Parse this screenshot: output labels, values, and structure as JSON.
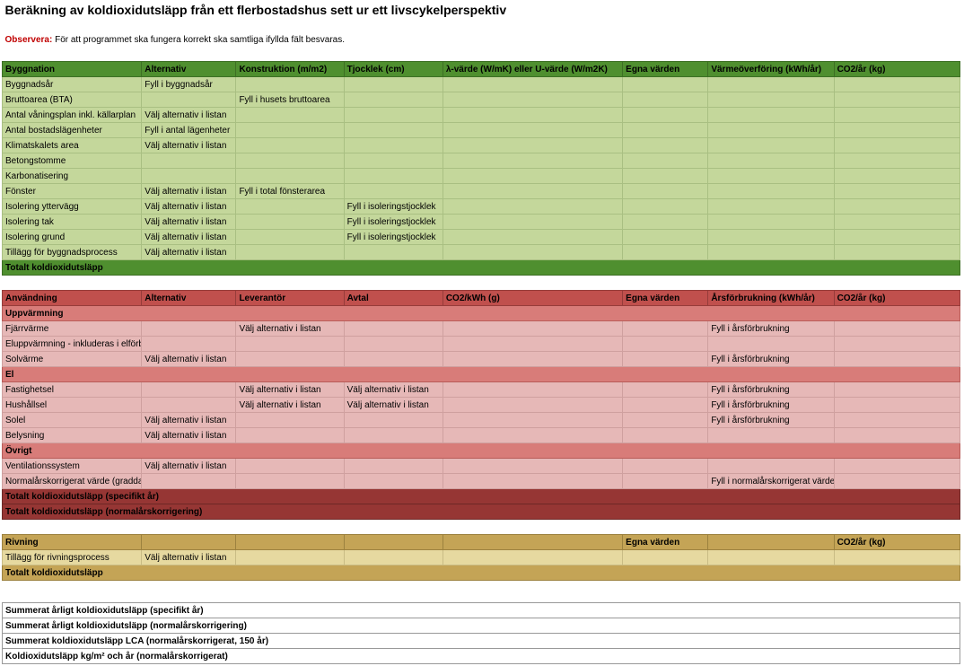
{
  "title": "Beräkning av koldioxidutsläpp från ett flerbostadshus sett ur ett livscykelperspektiv",
  "note_label": "Observera:",
  "note_text": "För att programmet ska fungera korrekt ska samtliga ifyllda fält besvaras.",
  "bygg": {
    "hdr": [
      "Byggnation",
      "Alternativ",
      "Konstruktion (m/m2)",
      "Tjocklek (cm)",
      "λ-värde (W/mK) eller U-värde (W/m2K)",
      "Egna värden",
      "Värmeöverföring (kWh/år)",
      "CO2/år (kg)"
    ],
    "rows": [
      {
        "c0": "Byggnadsår",
        "c1": "Fyll i byggnadsår"
      },
      {
        "c0": "Bruttoarea (BTA)",
        "c2": "Fyll i husets bruttoarea"
      },
      {
        "c0": "Antal våningsplan inkl. källarplan",
        "c1": "Välj alternativ i listan"
      },
      {
        "c0": "Antal bostadslägenheter",
        "c1": "Fyll i antal lägenheter"
      },
      {
        "c0": "Klimatskalets area",
        "c1": "Välj alternativ i listan"
      },
      {
        "c0": "Betongstomme"
      },
      {
        "c0": "Karbonatisering"
      },
      {
        "c0": "Fönster",
        "c1": "Välj alternativ i listan",
        "c2": "Fyll i total fönsterarea"
      },
      {
        "c0": "Isolering yttervägg",
        "c1": "Välj alternativ i listan",
        "c3": "Fyll i isoleringstjocklek"
      },
      {
        "c0": "Isolering tak",
        "c1": "Välj alternativ i listan",
        "c3": "Fyll i isoleringstjocklek"
      },
      {
        "c0": "Isolering grund",
        "c1": "Välj alternativ i listan",
        "c3": "Fyll i isoleringstjocklek"
      },
      {
        "c0": "Tillägg för byggnadsprocess",
        "c1": "Välj alternativ i listan"
      }
    ],
    "total": "Totalt koldioxidutsläpp"
  },
  "anv": {
    "hdr": [
      "Användning",
      "Alternativ",
      "Leverantör",
      "Avtal",
      "CO2/kWh (g)",
      "Egna värden",
      "Årsförbrukning (kWh/år)",
      "CO2/år (kg)"
    ],
    "sub1": "Uppvärmning",
    "rows1": [
      {
        "c0": "Fjärrvärme",
        "c2": "Välj alternativ i listan",
        "c6": "Fyll i årsförbrukning"
      },
      {
        "c0": "Eluppvärmning - inkluderas i elförbrukning"
      },
      {
        "c0": "Solvärme",
        "c1": "Välj alternativ i listan",
        "c6": "Fyll i årsförbrukning"
      }
    ],
    "sub2": "El",
    "rows2": [
      {
        "c0": "Fastighetsel",
        "c2": "Välj alternativ i listan",
        "c3": "Välj alternativ i listan",
        "c6": "Fyll i årsförbrukning"
      },
      {
        "c0": "Hushållsel",
        "c2": "Välj alternativ i listan",
        "c3": "Välj alternativ i listan",
        "c6": "Fyll i årsförbrukning"
      },
      {
        "c0": "Solel",
        "c1": "Välj alternativ i listan",
        "c6": "Fyll i årsförbrukning"
      },
      {
        "c0": "Belysning",
        "c1": "Välj alternativ i listan"
      }
    ],
    "sub3": "Övrigt",
    "rows3": [
      {
        "c0": "Ventilationssystem",
        "c1": "Välj alternativ i listan"
      },
      {
        "c0": "Normalårskorrigerat värde (graddagar)",
        "c6": "Fyll i normalårskorrigerat värde"
      }
    ],
    "total1": "Totalt koldioxidutsläpp (specifikt år)",
    "total2": "Totalt koldioxidutsläpp (normalårskorrigering)"
  },
  "riv": {
    "hdr": [
      "Rivning",
      "",
      "",
      "",
      "",
      "Egna värden",
      "",
      "CO2/år (kg)"
    ],
    "rows": [
      {
        "c0": "Tillägg för rivningsprocess",
        "c1": "Välj alternativ i listan"
      }
    ],
    "total": "Totalt koldioxidutsläpp"
  },
  "summary": [
    "Summerat årligt koldioxidutsläpp (specifikt år)",
    "Summerat årligt koldioxidutsläpp (normalårskorrigering)",
    "Summerat koldioxidutsläpp LCA (normalårskorrigerat, 150 år)",
    "Koldioxidutsläpp kg/m² och år (normalårskorrigerat)"
  ]
}
